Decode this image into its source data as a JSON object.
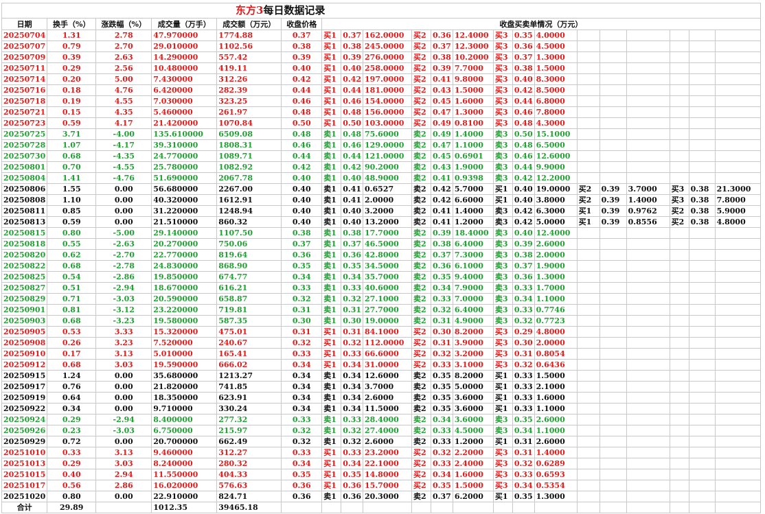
{
  "title": {
    "accent": "东方3",
    "rest": "每日数据记录"
  },
  "headers": {
    "date": "日期",
    "turnover": "换手（%）",
    "change": "涨跌幅（%）",
    "volume": "成交量（万手）",
    "amount": "成交额（万元）",
    "close": "收盘价格",
    "orders": "收盘买卖单情况（万元）"
  },
  "colors": {
    "up": "#e31b1b",
    "down": "#21a033",
    "flat": "#111111"
  },
  "rows": [
    {
      "d": "20250704",
      "t": "1.31",
      "c": "2.78",
      "v": "47.970000",
      "a": "1774.88",
      "p": "0.37",
      "tr": "r",
      "o": [
        [
          "买1",
          "0.37",
          "162.0000"
        ],
        [
          "买2",
          "0.36",
          "12.4000"
        ],
        [
          "买3",
          "0.35",
          "4.0000"
        ]
      ]
    },
    {
      "d": "20250707",
      "t": "0.79",
      "c": "2.70",
      "v": "29.010000",
      "a": "1102.56",
      "p": "0.38",
      "tr": "r",
      "o": [
        [
          "买1",
          "0.38",
          "245.0000"
        ],
        [
          "买2",
          "0.37",
          "12.3000"
        ],
        [
          "买3",
          "0.36",
          "4.5000"
        ]
      ]
    },
    {
      "d": "20250709",
      "t": "0.39",
      "c": "2.63",
      "v": "14.290000",
      "a": "557.42",
      "p": "0.39",
      "tr": "r",
      "o": [
        [
          "买1",
          "0.39",
          "276.0000"
        ],
        [
          "买2",
          "0.38",
          "10.2000"
        ],
        [
          "买3",
          "0.37",
          "1.3000"
        ]
      ]
    },
    {
      "d": "20250711",
      "t": "0.29",
      "c": "2.56",
      "v": "10.480000",
      "a": "419.11",
      "p": "0.40",
      "tr": "r",
      "o": [
        [
          "买1",
          "0.40",
          "258.0000"
        ],
        [
          "买2",
          "0.39",
          "7.7000"
        ],
        [
          "买3",
          "0.38",
          "1.5000"
        ]
      ]
    },
    {
      "d": "20250714",
      "t": "0.20",
      "c": "5.00",
      "v": "7.430000",
      "a": "312.26",
      "p": "0.42",
      "tr": "r",
      "o": [
        [
          "买1",
          "0.42",
          "197.0000"
        ],
        [
          "买2",
          "0.41",
          "9.8000"
        ],
        [
          "买3",
          "0.40",
          "8.3000"
        ]
      ]
    },
    {
      "d": "20250716",
      "t": "0.18",
      "c": "4.76",
      "v": "6.420000",
      "a": "282.39",
      "p": "0.44",
      "tr": "r",
      "o": [
        [
          "买1",
          "0.44",
          "181.0000"
        ],
        [
          "买2",
          "0.43",
          "1.5000"
        ],
        [
          "买3",
          "0.42",
          "8.5000"
        ]
      ]
    },
    {
      "d": "20250718",
      "t": "0.19",
      "c": "4.55",
      "v": "7.030000",
      "a": "323.25",
      "p": "0.46",
      "tr": "r",
      "o": [
        [
          "买1",
          "0.46",
          "154.0000"
        ],
        [
          "买2",
          "0.45",
          "1.6000"
        ],
        [
          "买3",
          "0.44",
          "6.8000"
        ]
      ]
    },
    {
      "d": "20250721",
      "t": "0.15",
      "c": "4.35",
      "v": "5.460000",
      "a": "261.97",
      "p": "0.48",
      "tr": "r",
      "o": [
        [
          "买1",
          "0.48",
          "156.0000"
        ],
        [
          "买2",
          "0.47",
          "1.3000"
        ],
        [
          "买3",
          "0.46",
          "7.8000"
        ]
      ]
    },
    {
      "d": "20250723",
      "t": "0.59",
      "c": "4.17",
      "v": "21.420000",
      "a": "1070.84",
      "p": "0.50",
      "tr": "r",
      "o": [
        [
          "买1",
          "0.50",
          "103.0000"
        ],
        [
          "买2",
          "0.49",
          "0.8100"
        ],
        [
          "买3",
          "0.48",
          "4.3000"
        ]
      ]
    },
    {
      "d": "20250725",
      "t": "3.71",
      "c": "-4.00",
      "v": "135.610000",
      "a": "6509.08",
      "p": "0.48",
      "tr": "g",
      "o": [
        [
          "卖1",
          "0.48",
          "75.6000"
        ],
        [
          "卖2",
          "0.49",
          "1.4000"
        ],
        [
          "卖3",
          "0.50",
          "15.1000"
        ]
      ]
    },
    {
      "d": "20250728",
      "t": "1.07",
      "c": "-4.17",
      "v": "39.310000",
      "a": "1808.31",
      "p": "0.46",
      "tr": "g",
      "o": [
        [
          "卖1",
          "0.46",
          "129.0000"
        ],
        [
          "卖2",
          "0.47",
          "1.1000"
        ],
        [
          "卖3",
          "0.48",
          "6.5000"
        ]
      ]
    },
    {
      "d": "20250730",
      "t": "0.68",
      "c": "-4.35",
      "v": "24.770000",
      "a": "1089.71",
      "p": "0.44",
      "tr": "g",
      "o": [
        [
          "卖1",
          "0.44",
          "121.0000"
        ],
        [
          "卖2",
          "0.45",
          "0.6901"
        ],
        [
          "卖3",
          "0.46",
          "12.6000"
        ]
      ]
    },
    {
      "d": "20250801",
      "t": "0.70",
      "c": "-4.55",
      "v": "25.780000",
      "a": "1082.92",
      "p": "0.42",
      "tr": "g",
      "o": [
        [
          "卖1",
          "0.42",
          "90.2000"
        ],
        [
          "卖2",
          "0.43",
          "1.9000"
        ],
        [
          "卖3",
          "0.44",
          "9.9000"
        ]
      ]
    },
    {
      "d": "20250804",
      "t": "1.41",
      "c": "-4.76",
      "v": "51.690000",
      "a": "2067.78",
      "p": "0.40",
      "tr": "g",
      "o": [
        [
          "卖1",
          "0.40",
          "48.9000"
        ],
        [
          "卖2",
          "0.41",
          "0.9398"
        ],
        [
          "卖3",
          "0.42",
          "12.2000"
        ]
      ]
    },
    {
      "d": "20250806",
      "t": "1.55",
      "c": "0.00",
      "v": "56.680000",
      "a": "2267.00",
      "p": "0.40",
      "tr": "k",
      "o": [
        [
          "卖1",
          "0.41",
          "0.6527"
        ],
        [
          "卖2",
          "0.42",
          "5.7000"
        ],
        [
          "买1",
          "0.40",
          "19.0000"
        ],
        [
          "买2",
          "0.39",
          "3.7000"
        ],
        [
          "买3",
          "0.38",
          "21.3000"
        ]
      ]
    },
    {
      "d": "20250808",
      "t": "1.10",
      "c": "0.00",
      "v": "40.320000",
      "a": "1612.91",
      "p": "0.40",
      "tr": "k",
      "o": [
        [
          "卖1",
          "0.41",
          "2.0000"
        ],
        [
          "卖2",
          "0.42",
          "6.6000"
        ],
        [
          "买1",
          "0.40",
          "3.8000"
        ],
        [
          "买2",
          "0.39",
          "1.4000"
        ],
        [
          "买3",
          "0.38",
          "7.8000"
        ]
      ]
    },
    {
      "d": "20250811",
      "t": "0.85",
      "c": "0.00",
      "v": "31.220000",
      "a": "1248.94",
      "p": "0.40",
      "tr": "k",
      "o": [
        [
          "卖1",
          "0.40",
          "3.2000"
        ],
        [
          "卖2",
          "0.41",
          "1.4000"
        ],
        [
          "卖3",
          "0.42",
          "6.3000"
        ],
        [
          "买1",
          "0.39",
          "0.9762"
        ],
        [
          "买2",
          "0.38",
          "5.9000"
        ]
      ]
    },
    {
      "d": "20250813",
      "t": "0.59",
      "c": "0.00",
      "v": "21.510000",
      "a": "860.32",
      "p": "0.40",
      "tr": "k",
      "o": [
        [
          "卖1",
          "0.40",
          "13.2000"
        ],
        [
          "卖2",
          "0.41",
          "1.2000"
        ],
        [
          "卖3",
          "0.42",
          "5.0000"
        ],
        [
          "买1",
          "0.39",
          "0.8556"
        ],
        [
          "买2",
          "0.38",
          "4.8000"
        ]
      ]
    },
    {
      "d": "20250815",
      "t": "0.80",
      "c": "-5.00",
      "v": "29.140000",
      "a": "1107.50",
      "p": "0.38",
      "tr": "g",
      "o": [
        [
          "卖1",
          "0.38",
          "17.7000"
        ],
        [
          "卖2",
          "0.39",
          "18.4000"
        ],
        [
          "卖3",
          "0.40",
          "12.4000"
        ]
      ]
    },
    {
      "d": "20250818",
      "t": "0.55",
      "c": "-2.63",
      "v": "20.270000",
      "a": "750.06",
      "p": "0.37",
      "tr": "g",
      "o": [
        [
          "卖1",
          "0.37",
          "46.5000"
        ],
        [
          "卖2",
          "0.38",
          "6.4000"
        ],
        [
          "卖3",
          "0.39",
          "2.6000"
        ]
      ]
    },
    {
      "d": "20250820",
      "t": "0.62",
      "c": "-2.70",
      "v": "22.770000",
      "a": "819.64",
      "p": "0.36",
      "tr": "g",
      "o": [
        [
          "卖1",
          "0.36",
          "42.8000"
        ],
        [
          "卖2",
          "0.37",
          "7.3000"
        ],
        [
          "卖3",
          "0.38",
          "2.0000"
        ]
      ]
    },
    {
      "d": "20250822",
      "t": "0.68",
      "c": "-2.78",
      "v": "24.830000",
      "a": "868.90",
      "p": "0.35",
      "tr": "g",
      "o": [
        [
          "卖1",
          "0.35",
          "34.5000"
        ],
        [
          "卖2",
          "0.36",
          "6.1000"
        ],
        [
          "卖3",
          "0.37",
          "1.9000"
        ]
      ]
    },
    {
      "d": "20250825",
      "t": "0.54",
      "c": "-2.86",
      "v": "19.850000",
      "a": "674.77",
      "p": "0.34",
      "tr": "g",
      "o": [
        [
          "卖1",
          "0.34",
          "35.7000"
        ],
        [
          "卖2",
          "0.35",
          "9.4000"
        ],
        [
          "卖3",
          "0.36",
          "1.3000"
        ]
      ]
    },
    {
      "d": "20250827",
      "t": "0.51",
      "c": "-2.94",
      "v": "18.670000",
      "a": "616.21",
      "p": "0.33",
      "tr": "g",
      "o": [
        [
          "卖1",
          "0.33",
          "40.6000"
        ],
        [
          "卖2",
          "0.34",
          "7.9000"
        ],
        [
          "卖3",
          "0.33",
          "1.7000"
        ]
      ]
    },
    {
      "d": "20250829",
      "t": "0.71",
      "c": "-3.03",
      "v": "20.590000",
      "a": "658.87",
      "p": "0.32",
      "tr": "g",
      "o": [
        [
          "卖1",
          "0.32",
          "27.1000"
        ],
        [
          "卖2",
          "0.33",
          "7.0000"
        ],
        [
          "卖3",
          "0.34",
          "1.1000"
        ]
      ]
    },
    {
      "d": "20250901",
      "t": "0.81",
      "c": "-3.12",
      "v": "23.220000",
      "a": "719.81",
      "p": "0.31",
      "tr": "g",
      "o": [
        [
          "卖1",
          "0.31",
          "27.7000"
        ],
        [
          "卖2",
          "0.32",
          "6.4000"
        ],
        [
          "卖3",
          "0.33",
          "0.7746"
        ]
      ]
    },
    {
      "d": "20250903",
      "t": "0.68",
      "c": "-3.23",
      "v": "19.580000",
      "a": "587.35",
      "p": "0.30",
      "tr": "g",
      "o": [
        [
          "卖1",
          "0.30",
          "19.0000"
        ],
        [
          "卖2",
          "0.31",
          "4.9000"
        ],
        [
          "卖3",
          "0.32",
          "0.7723"
        ]
      ]
    },
    {
      "d": "20250905",
      "t": "0.53",
      "c": "3.33",
      "v": "15.320000",
      "a": "475.01",
      "p": "0.31",
      "tr": "r",
      "o": [
        [
          "买1",
          "0.31",
          "84.1000"
        ],
        [
          "买2",
          "0.30",
          "8.2000"
        ],
        [
          "买3",
          "0.29",
          "4.8000"
        ]
      ]
    },
    {
      "d": "20250908",
      "t": "0.26",
      "c": "3.23",
      "v": "7.520000",
      "a": "240.67",
      "p": "0.32",
      "tr": "r",
      "o": [
        [
          "买1",
          "0.32",
          "112.0000"
        ],
        [
          "买2",
          "0.31",
          "3.9000"
        ],
        [
          "买3",
          "0.30",
          "2.0000"
        ]
      ]
    },
    {
      "d": "20250910",
      "t": "0.17",
      "c": "3.13",
      "v": "5.010000",
      "a": "165.41",
      "p": "0.33",
      "tr": "r",
      "o": [
        [
          "买1",
          "0.33",
          "66.6000"
        ],
        [
          "买2",
          "0.32",
          "3.2000"
        ],
        [
          "买3",
          "0.31",
          "0.8054"
        ]
      ]
    },
    {
      "d": "20250912",
      "t": "0.68",
      "c": "3.03",
      "v": "19.590000",
      "a": "666.02",
      "p": "0.34",
      "tr": "r",
      "o": [
        [
          "买1",
          "0.34",
          "31.0000"
        ],
        [
          "买2",
          "0.33",
          "3.1000"
        ],
        [
          "买3",
          "0.32",
          "0.6436"
        ]
      ]
    },
    {
      "d": "20250915",
      "t": "1.24",
      "c": "0.00",
      "v": "35.680000",
      "a": "1213.27",
      "p": "0.34",
      "tr": "k",
      "o": [
        [
          "卖1",
          "0.34",
          "12.6000"
        ],
        [
          "卖2",
          "0.35",
          "8.2000"
        ],
        [
          "买1",
          "0.33",
          "1.5000"
        ]
      ]
    },
    {
      "d": "20250917",
      "t": "0.76",
      "c": "0.00",
      "v": "21.820000",
      "a": "741.85",
      "p": "0.34",
      "tr": "k",
      "o": [
        [
          "卖1",
          "0.34",
          "3.7000"
        ],
        [
          "卖2",
          "0.35",
          "5.0000"
        ],
        [
          "买1",
          "0.33",
          "2.1000"
        ]
      ]
    },
    {
      "d": "20250919",
      "t": "0.64",
      "c": "0.00",
      "v": "18.350000",
      "a": "623.91",
      "p": "0.34",
      "tr": "k",
      "o": [
        [
          "卖1",
          "0.34",
          "2.6000"
        ],
        [
          "卖2",
          "0.35",
          "3.6000"
        ],
        [
          "买1",
          "0.33",
          "1.6000"
        ]
      ]
    },
    {
      "d": "20250922",
      "t": "0.34",
      "c": "0.00",
      "v": "9.710000",
      "a": "330.24",
      "p": "0.34",
      "tr": "k",
      "o": [
        [
          "卖1",
          "0.34",
          "11.5000"
        ],
        [
          "卖2",
          "0.35",
          "3.6000"
        ],
        [
          "买1",
          "0.33",
          "1.1000"
        ]
      ]
    },
    {
      "d": "20250924",
      "t": "0.29",
      "c": "-2.94",
      "v": "8.400000",
      "a": "277.32",
      "p": "0.33",
      "tr": "g",
      "o": [
        [
          "卖1",
          "0.33",
          "28.4000"
        ],
        [
          "卖2",
          "0.34",
          "3.6000"
        ],
        [
          "卖3",
          "0.35",
          "2.6000"
        ]
      ]
    },
    {
      "d": "20250926",
      "t": "0.23",
      "c": "-3.03",
      "v": "6.750000",
      "a": "215.97",
      "p": "0.32",
      "tr": "g",
      "o": [
        [
          "卖1",
          "0.32",
          "27.4000"
        ],
        [
          "卖2",
          "0.33",
          "4.5000"
        ],
        [
          "卖3",
          "0.34",
          "1.1000"
        ]
      ]
    },
    {
      "d": "20250929",
      "t": "0.72",
      "c": "0.00",
      "v": "20.700000",
      "a": "662.49",
      "p": "0.32",
      "tr": "k",
      "o": [
        [
          "卖1",
          "0.32",
          "2.6000"
        ],
        [
          "卖2",
          "0.33",
          "1.2000"
        ],
        [
          "买1",
          "0.31",
          "2.6000"
        ]
      ]
    },
    {
      "d": "20251010",
      "t": "0.33",
      "c": "3.13",
      "v": "9.460000",
      "a": "312.27",
      "p": "0.33",
      "tr": "r",
      "o": [
        [
          "买1",
          "0.33",
          "23.2000"
        ],
        [
          "买2",
          "0.32",
          "2.2000"
        ],
        [
          "买3",
          "0.31",
          "1.4000"
        ]
      ]
    },
    {
      "d": "20251013",
      "t": "0.29",
      "c": "3.03",
      "v": "8.240000",
      "a": "280.32",
      "p": "0.34",
      "tr": "r",
      "o": [
        [
          "买1",
          "0.34",
          "22.1000"
        ],
        [
          "买2",
          "0.33",
          "2.4000"
        ],
        [
          "买3",
          "0.32",
          "0.6289"
        ]
      ]
    },
    {
      "d": "20251015",
      "t": "0.40",
      "c": "2.94",
      "v": "11.550000",
      "a": "404.33",
      "p": "0.35",
      "tr": "r",
      "o": [
        [
          "买1",
          "0.35",
          "14.8000"
        ],
        [
          "买2",
          "0.34",
          "1.6000"
        ],
        [
          "买3",
          "0.33",
          "0.6593"
        ]
      ]
    },
    {
      "d": "20251017",
      "t": "0.56",
      "c": "2.86",
      "v": "16.020000",
      "a": "576.63",
      "p": "0.36",
      "tr": "r",
      "o": [
        [
          "买1",
          "0.36",
          "15.7000"
        ],
        [
          "买2",
          "0.35",
          "1.5000"
        ],
        [
          "买3",
          "0.34",
          "0.5354"
        ]
      ]
    },
    {
      "d": "20251020",
      "t": "0.80",
      "c": "0.00",
      "v": "22.910000",
      "a": "824.71",
      "p": "0.36",
      "tr": "k",
      "o": [
        [
          "卖1",
          "0.36",
          "20.3000"
        ],
        [
          "卖2",
          "0.37",
          "6.2000"
        ],
        [
          "买1",
          "0.35",
          "1.3000"
        ]
      ]
    }
  ],
  "total": {
    "label": "合计",
    "turnover": "29.89",
    "volume": "1012.35",
    "amount": "39465.18"
  }
}
